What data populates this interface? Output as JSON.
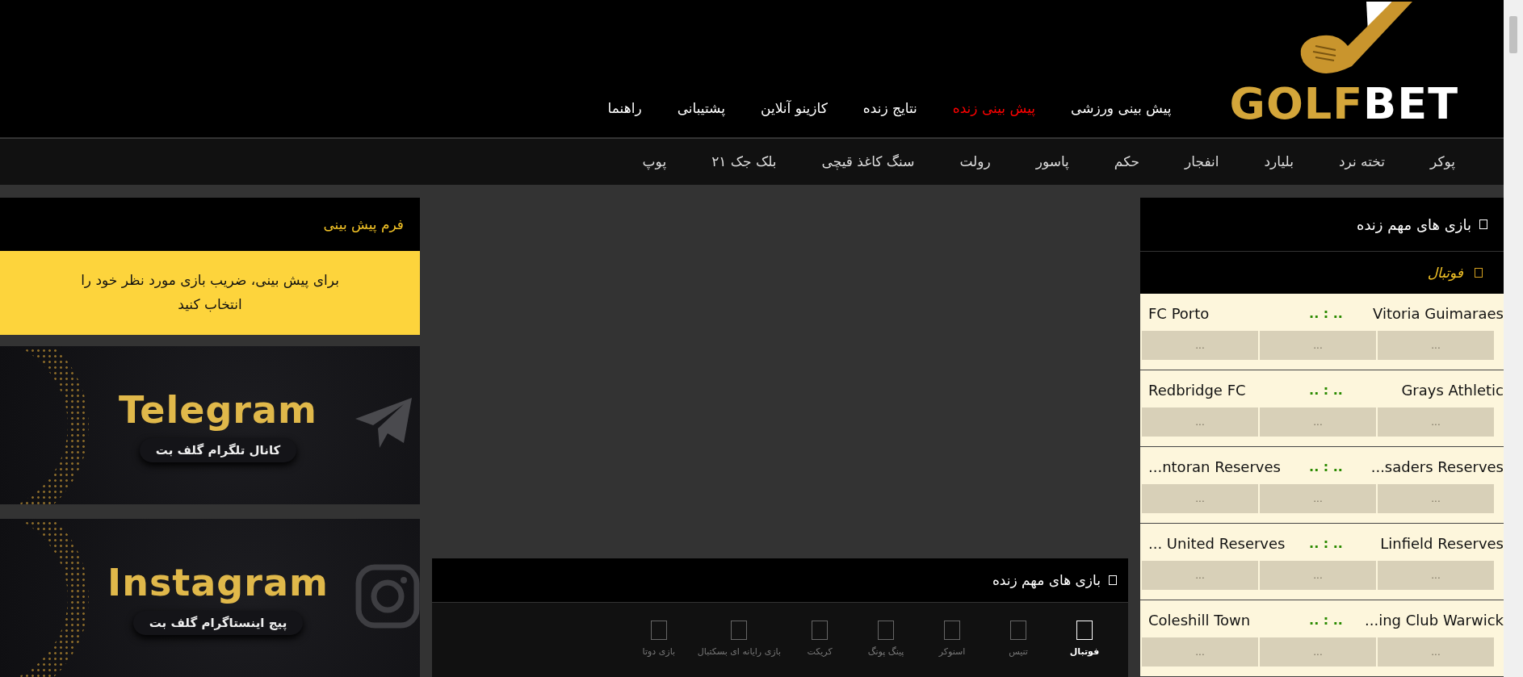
{
  "logo": {
    "part1": "GOLF",
    "part2": "BET"
  },
  "nav": {
    "items": [
      {
        "label": "پیش بینی ورزشی",
        "selected": false
      },
      {
        "label": "پیش بینی زنده",
        "selected": true
      },
      {
        "label": "نتایج زنده",
        "selected": false
      },
      {
        "label": "کازینو آنلاین",
        "selected": false
      },
      {
        "label": "پشتیبانی",
        "selected": false
      },
      {
        "label": "راهنما",
        "selected": false
      }
    ]
  },
  "games_bar": {
    "items": [
      "پوکر",
      "تخته نرد",
      "بلیارد",
      "انفجار",
      "حکم",
      "پاسور",
      "رولت",
      "سنگ کاغذ قیچی",
      "بلک جک ۲۱",
      "پوپ"
    ]
  },
  "live_panel": {
    "title": "بازی های مهم زنده",
    "sport": "فوتبال",
    "matches": [
      {
        "home": "Vitoria Guimaraes",
        "score": ".. : ..",
        "away": "FC Porto",
        "odds": [
          "...",
          "...",
          "..."
        ]
      },
      {
        "home": "Grays Athletic",
        "score": ".. : ..",
        "away": "Redbridge FC",
        "odds": [
          "...",
          "...",
          "..."
        ]
      },
      {
        "home": "...saders Reserves",
        "score": ".. : ..",
        "away": "...ntoran Reserves",
        "odds": [
          "...",
          "...",
          "..."
        ]
      },
      {
        "home": "Linfield Reserves",
        "score": ".. : ..",
        "away": "... United Reserves",
        "odds": [
          "...",
          "...",
          "..."
        ]
      },
      {
        "home": "...ing Club Warwick",
        "score": ".. : ..",
        "away": "Coleshill Town",
        "odds": [
          "...",
          "...",
          "..."
        ]
      }
    ]
  },
  "sports_panel": {
    "title": "بازی های مهم زنده",
    "tabs": [
      {
        "label": "فوتبال",
        "selected": true
      },
      {
        "label": "تنیس",
        "selected": false
      },
      {
        "label": "اسنوکر",
        "selected": false
      },
      {
        "label": "پینگ پونگ",
        "selected": false
      },
      {
        "label": "کریکت",
        "selected": false
      },
      {
        "label": "بازی رایانه ای بسکتبال",
        "selected": false
      },
      {
        "label": "بازی دوتا",
        "selected": false
      }
    ]
  },
  "form_panel": {
    "title": "فرم پیش بینی",
    "message": "برای پیش بینی، ضریب بازی مورد نظر خود را انتخاب کنید"
  },
  "banners": [
    {
      "kind": "telegram",
      "title": "Telegram",
      "subtitle": "کانال تلگرام گلف بت"
    },
    {
      "kind": "instagram",
      "title": "Instagram",
      "subtitle": "پیج اینستاگرام گلف بت"
    }
  ]
}
